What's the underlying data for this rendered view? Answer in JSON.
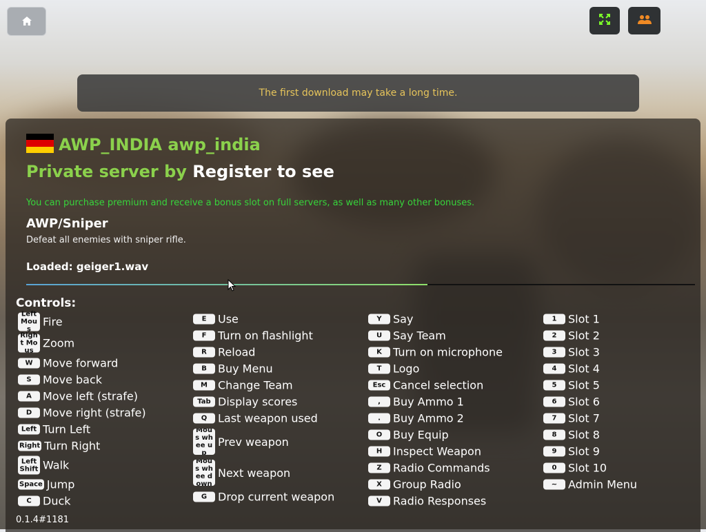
{
  "notice": "The first download may take a long time.",
  "server": {
    "name": "AWP_INDIA awp_india",
    "private_prefix": "Private server by",
    "private_owner": "Register to see",
    "premium_text": "You can purchase premium and receive a bonus slot on full servers, as well as many other bonuses.",
    "flag_colors": [
      "#000000",
      "#dd0000",
      "#ffce00"
    ]
  },
  "mode": {
    "title": "AWP/Sniper",
    "description": "Defeat all enemies with sniper rifle."
  },
  "loading": {
    "text": "Loaded: geiger1.wav",
    "progress": 0.6
  },
  "controls_label": "Controls:",
  "controls": {
    "col1": [
      {
        "key": "Left Mous",
        "action": "Fire"
      },
      {
        "key": "Right Mous",
        "action": "Zoom"
      },
      {
        "key": "W",
        "action": "Move forward"
      },
      {
        "key": "S",
        "action": "Move back"
      },
      {
        "key": "A",
        "action": "Move left (strafe)"
      },
      {
        "key": "D",
        "action": "Move right (strafe)"
      },
      {
        "key": "Left",
        "action": "Turn Left"
      },
      {
        "key": "Right",
        "action": "Turn Right"
      },
      {
        "key": "Left Shift",
        "action": "Walk"
      },
      {
        "key": "Space",
        "action": "Jump"
      },
      {
        "key": "C",
        "action": "Duck"
      }
    ],
    "col2": [
      {
        "key": "E",
        "action": "Use"
      },
      {
        "key": "F",
        "action": "Turn on flashlight"
      },
      {
        "key": "R",
        "action": "Reload"
      },
      {
        "key": "B",
        "action": "Buy Menu"
      },
      {
        "key": "M",
        "action": "Change Team"
      },
      {
        "key": "Tab",
        "action": "Display scores"
      },
      {
        "key": "Q",
        "action": "Last weapon used"
      },
      {
        "key": "Mous whee up",
        "action": "Prev weapon"
      },
      {
        "key": "Mous whee down",
        "action": "Next weapon"
      },
      {
        "key": "G",
        "action": "Drop current weapon"
      }
    ],
    "col3": [
      {
        "key": "Y",
        "action": "Say"
      },
      {
        "key": "U",
        "action": "Say Team"
      },
      {
        "key": "K",
        "action": "Turn on microphone"
      },
      {
        "key": "T",
        "action": "Logo"
      },
      {
        "key": "Esc",
        "action": "Cancel selection"
      },
      {
        "key": ",",
        "action": "Buy Ammo 1"
      },
      {
        "key": ".",
        "action": "Buy Ammo 2"
      },
      {
        "key": "O",
        "action": "Buy Equip"
      },
      {
        "key": "H",
        "action": "Inspect Weapon"
      },
      {
        "key": "Z",
        "action": "Radio Commands"
      },
      {
        "key": "X",
        "action": "Group Radio"
      },
      {
        "key": "V",
        "action": "Radio Responses"
      }
    ],
    "col4": [
      {
        "key": "1",
        "action": "Slot 1"
      },
      {
        "key": "2",
        "action": "Slot 2"
      },
      {
        "key": "3",
        "action": "Slot 3"
      },
      {
        "key": "4",
        "action": "Slot 4"
      },
      {
        "key": "5",
        "action": "Slot 5"
      },
      {
        "key": "6",
        "action": "Slot 6"
      },
      {
        "key": "7",
        "action": "Slot 7"
      },
      {
        "key": "8",
        "action": "Slot 8"
      },
      {
        "key": "9",
        "action": "Slot 9"
      },
      {
        "key": "0",
        "action": "Slot 10"
      },
      {
        "key": "~",
        "action": "Admin Menu"
      }
    ]
  },
  "version": "0.1.4#1181",
  "icons": {
    "home": "home-icon",
    "fullscreen": "fullscreen-icon",
    "players": "players-icon"
  },
  "colors": {
    "accent_green": "#8bd14c",
    "premium_green": "#37d53b",
    "notice_text": "#e6c45b",
    "fullscreen_icon": "#7dff2a",
    "players_icon": "#f08a24"
  }
}
